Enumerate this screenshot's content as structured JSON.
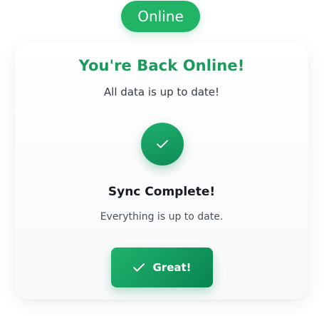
{
  "status_badge": {
    "label": "Online"
  },
  "card": {
    "title": "You're Back Online!",
    "subtitle": "All data is up to date!",
    "sync_title": "Sync Complete!",
    "sync_description": "Everything is up to date.",
    "status_icon": "check-icon",
    "button": {
      "label": "Great!",
      "icon": "check-icon"
    }
  },
  "colors": {
    "accent": "#1a9a5c",
    "badge_background": "#22b466",
    "button_gradient_start": "#1eb36e",
    "button_gradient_end": "#0a8450"
  }
}
